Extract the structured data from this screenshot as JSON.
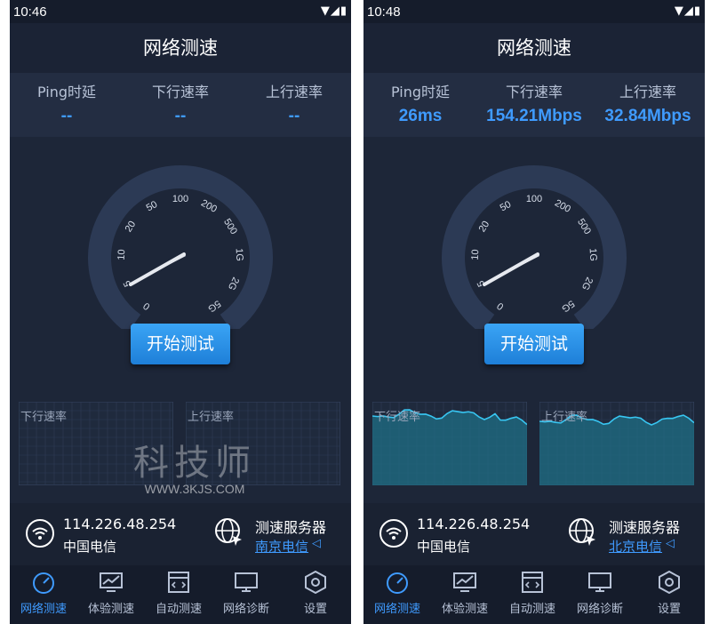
{
  "screens": [
    {
      "status": {
        "time": "10:46"
      },
      "title": "网络测速",
      "stats": [
        {
          "label": "Ping时延",
          "value": "--"
        },
        {
          "label": "下行速率",
          "value": "--"
        },
        {
          "label": "上行速率",
          "value": "--"
        }
      ],
      "gauge": {
        "ticks": [
          "0",
          "5",
          "10",
          "20",
          "50",
          "100",
          "200",
          "500",
          "1G",
          "2G",
          "5G"
        ]
      },
      "start_button": "开始测试",
      "graphs": [
        {
          "label": "下行速率"
        },
        {
          "label": "上行速率"
        }
      ],
      "info": {
        "ip": "114.226.48.254",
        "isp": "中国电信",
        "server_label": "测速服务器",
        "server": "南京电信"
      },
      "tabs": [
        {
          "label": "网络测速",
          "icon": "speedometer-icon",
          "active": true
        },
        {
          "label": "体验测速",
          "icon": "chart-monitor-icon",
          "active": false
        },
        {
          "label": "自动测速",
          "icon": "code-window-icon",
          "active": false
        },
        {
          "label": "网络诊断",
          "icon": "monitor-icon",
          "active": false
        },
        {
          "label": "设置",
          "icon": "gear-icon",
          "active": false
        }
      ]
    },
    {
      "status": {
        "time": "10:48"
      },
      "title": "网络测速",
      "stats": [
        {
          "label": "Ping时延",
          "value": "26ms"
        },
        {
          "label": "下行速率",
          "value": "154.21Mbps"
        },
        {
          "label": "上行速率",
          "value": "32.84Mbps"
        }
      ],
      "gauge": {
        "ticks": [
          "0",
          "5",
          "10",
          "20",
          "50",
          "100",
          "200",
          "500",
          "1G",
          "2G",
          "5G"
        ]
      },
      "start_button": "开始测试",
      "graphs": [
        {
          "label": "下行速率"
        },
        {
          "label": "上行速率"
        }
      ],
      "info": {
        "ip": "114.226.48.254",
        "isp": "中国电信",
        "server_label": "测速服务器",
        "server": "北京电信"
      },
      "tabs": [
        {
          "label": "网络测速",
          "icon": "speedometer-icon",
          "active": true
        },
        {
          "label": "体验测速",
          "icon": "chart-monitor-icon",
          "active": false
        },
        {
          "label": "自动测速",
          "icon": "code-window-icon",
          "active": false
        },
        {
          "label": "网络诊断",
          "icon": "monitor-icon",
          "active": false
        },
        {
          "label": "设置",
          "icon": "gear-icon",
          "active": false
        }
      ]
    }
  ],
  "watermark": {
    "text": "科技师",
    "url": "WWW.3KJS.COM"
  },
  "colors": {
    "accent": "#3f9bff",
    "background": "#1d2638",
    "button": "#2a8fe8"
  }
}
